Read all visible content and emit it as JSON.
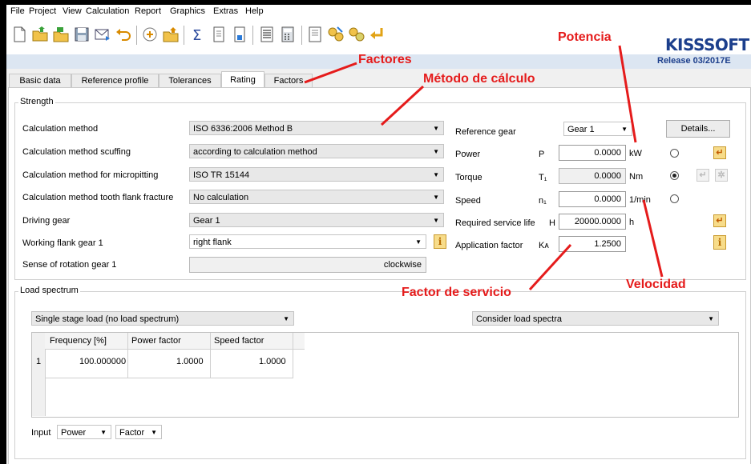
{
  "menu": [
    "File",
    "Project",
    "View",
    "Calculation",
    "Report",
    "Graphics",
    "Extras",
    "Help"
  ],
  "brand": {
    "logo": "KISSsoft",
    "logo_text": "KISSSOFT",
    "release": "Release 03/2017E"
  },
  "tabs": [
    "Basic data",
    "Reference profile",
    "Tolerances",
    "Rating",
    "Factors"
  ],
  "active_tab": "Rating",
  "strength": {
    "title": "Strength",
    "rows": [
      {
        "label": "Calculation method",
        "value": "ISO 6336:2006 Method B"
      },
      {
        "label": "Calculation method scuffing",
        "value": "according to calculation method"
      },
      {
        "label": "Calculation method for micropitting",
        "value": "ISO TR 15144"
      },
      {
        "label": "Calculation method tooth flank fracture",
        "value": "No calculation"
      },
      {
        "label": "Driving gear",
        "value": "Gear 1"
      },
      {
        "label": "Working flank gear 1",
        "value": "right flank"
      }
    ],
    "rotation": {
      "label": "Sense of rotation gear 1",
      "value": "clockwise"
    },
    "reference_gear": {
      "label": "Reference gear",
      "value": "Gear 1"
    },
    "details_button": "Details...",
    "power": {
      "label": "Power",
      "symbol": "P",
      "value": "0.0000",
      "unit": "kW"
    },
    "torque": {
      "label": "Torque",
      "symbol": "T₁",
      "value": "0.0000",
      "unit": "Nm"
    },
    "speed": {
      "label": "Speed",
      "symbol": "n₁",
      "value": "0.0000",
      "unit": "1/min"
    },
    "service_life": {
      "label": "Required service life",
      "symbol": "H",
      "value": "20000.0000",
      "unit": "h"
    },
    "application_factor": {
      "label": "Application factor",
      "symbol": "Kᴀ",
      "value": "1.2500"
    },
    "selected_radio": "torque"
  },
  "load_spectrum": {
    "title": "Load spectrum",
    "type": "Single stage load (no load spectrum)",
    "consider": "Consider load spectra",
    "columns": [
      "Frequency [%]",
      "Power factor",
      "Speed factor"
    ],
    "rows": [
      {
        "index": "1",
        "cells": [
          "100.000000",
          "1.0000",
          "1.0000"
        ]
      }
    ],
    "input_label": "Input",
    "input_value": "Power",
    "input_mode": "Factor"
  },
  "annotations": {
    "factores": "Factores",
    "metodo": "Método de cálculo",
    "potencia": "Potencia",
    "factor_servicio": "Factor de servicio",
    "velocidad": "Velocidad"
  },
  "colors": {
    "annotation": "#e51b1b",
    "brand": "#1c3f8c",
    "brand_bar": "#dce6f2"
  }
}
